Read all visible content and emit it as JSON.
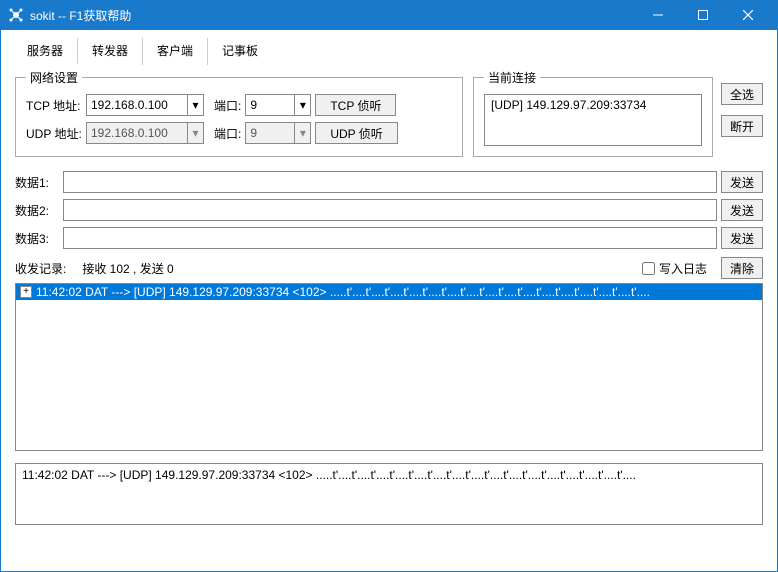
{
  "titlebar": {
    "title": "sokit -- F1获取帮助"
  },
  "tabs": [
    "服务器",
    "转发器",
    "客户端",
    "记事板"
  ],
  "net": {
    "legend": "网络设置",
    "tcp_label": "TCP 地址:",
    "tcp_addr": "192.168.0.100",
    "udp_label": "UDP 地址:",
    "udp_addr": "192.168.0.100",
    "port_label": "端口:",
    "tcp_port": "9",
    "udp_port": "9",
    "tcp_listen": "TCP 侦听",
    "udp_listen": "UDP 侦听"
  },
  "conn": {
    "legend": "当前连接",
    "items": [
      "[UDP] 149.129.97.209:33734"
    ],
    "select_all": "全选",
    "disconnect": "断开"
  },
  "data": {
    "label1": "数据1:",
    "label2": "数据2:",
    "label3": "数据3:",
    "val1": "",
    "val2": "",
    "val3": "",
    "send": "发送"
  },
  "log": {
    "label": "收发记录:",
    "stats": "接收 102 , 发送 0",
    "write_log": "写入日志",
    "clear": "清除",
    "entry": "11:42:02 DAT ---> [UDP] 149.129.97.209:33734 <102> .....t'....t'....t'....t'....t'....t'....t'....t'....t'....t'....t'....t'....t'....t'....t'....t'...."
  },
  "detail": "11:42:02 DAT ---> [UDP] 149.129.97.209:33734 <102> .....t'....t'....t'....t'....t'....t'....t'....t'....t'....t'....t'....t'....t'....t'....t'....t'....",
  "watermark": ""
}
